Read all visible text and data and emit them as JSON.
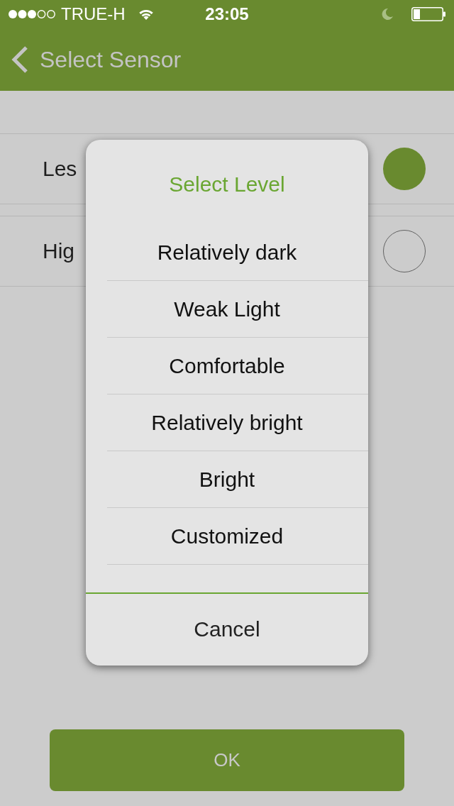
{
  "status_bar": {
    "carrier": "TRUE-H",
    "time": "23:05"
  },
  "nav_bar": {
    "title": "Select Sensor"
  },
  "options": [
    {
      "label": "Les",
      "selected": true
    },
    {
      "label": "Hig",
      "selected": false
    }
  ],
  "dialog": {
    "title": "Select Level",
    "items": [
      "Relatively dark",
      "Weak Light",
      "Comfortable",
      "Relatively bright",
      "Bright",
      "Customized"
    ],
    "cancel": "Cancel"
  },
  "ok_button": "OK"
}
